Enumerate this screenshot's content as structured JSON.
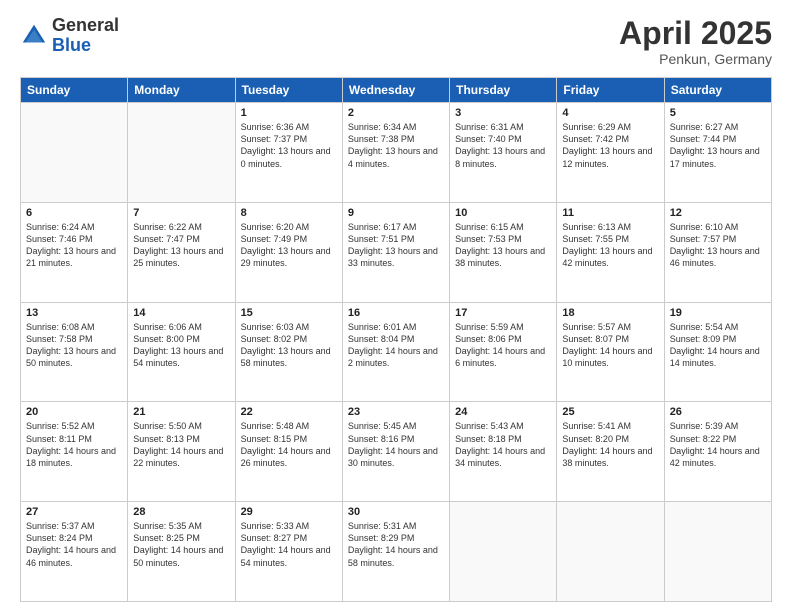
{
  "logo": {
    "general": "General",
    "blue": "Blue"
  },
  "header": {
    "month": "April 2025",
    "location": "Penkun, Germany"
  },
  "weekdays": [
    "Sunday",
    "Monday",
    "Tuesday",
    "Wednesday",
    "Thursday",
    "Friday",
    "Saturday"
  ],
  "weeks": [
    [
      {
        "day": "",
        "info": ""
      },
      {
        "day": "",
        "info": ""
      },
      {
        "day": "1",
        "info": "Sunrise: 6:36 AM\nSunset: 7:37 PM\nDaylight: 13 hours and 0 minutes."
      },
      {
        "day": "2",
        "info": "Sunrise: 6:34 AM\nSunset: 7:38 PM\nDaylight: 13 hours and 4 minutes."
      },
      {
        "day": "3",
        "info": "Sunrise: 6:31 AM\nSunset: 7:40 PM\nDaylight: 13 hours and 8 minutes."
      },
      {
        "day": "4",
        "info": "Sunrise: 6:29 AM\nSunset: 7:42 PM\nDaylight: 13 hours and 12 minutes."
      },
      {
        "day": "5",
        "info": "Sunrise: 6:27 AM\nSunset: 7:44 PM\nDaylight: 13 hours and 17 minutes."
      }
    ],
    [
      {
        "day": "6",
        "info": "Sunrise: 6:24 AM\nSunset: 7:46 PM\nDaylight: 13 hours and 21 minutes."
      },
      {
        "day": "7",
        "info": "Sunrise: 6:22 AM\nSunset: 7:47 PM\nDaylight: 13 hours and 25 minutes."
      },
      {
        "day": "8",
        "info": "Sunrise: 6:20 AM\nSunset: 7:49 PM\nDaylight: 13 hours and 29 minutes."
      },
      {
        "day": "9",
        "info": "Sunrise: 6:17 AM\nSunset: 7:51 PM\nDaylight: 13 hours and 33 minutes."
      },
      {
        "day": "10",
        "info": "Sunrise: 6:15 AM\nSunset: 7:53 PM\nDaylight: 13 hours and 38 minutes."
      },
      {
        "day": "11",
        "info": "Sunrise: 6:13 AM\nSunset: 7:55 PM\nDaylight: 13 hours and 42 minutes."
      },
      {
        "day": "12",
        "info": "Sunrise: 6:10 AM\nSunset: 7:57 PM\nDaylight: 13 hours and 46 minutes."
      }
    ],
    [
      {
        "day": "13",
        "info": "Sunrise: 6:08 AM\nSunset: 7:58 PM\nDaylight: 13 hours and 50 minutes."
      },
      {
        "day": "14",
        "info": "Sunrise: 6:06 AM\nSunset: 8:00 PM\nDaylight: 13 hours and 54 minutes."
      },
      {
        "day": "15",
        "info": "Sunrise: 6:03 AM\nSunset: 8:02 PM\nDaylight: 13 hours and 58 minutes."
      },
      {
        "day": "16",
        "info": "Sunrise: 6:01 AM\nSunset: 8:04 PM\nDaylight: 14 hours and 2 minutes."
      },
      {
        "day": "17",
        "info": "Sunrise: 5:59 AM\nSunset: 8:06 PM\nDaylight: 14 hours and 6 minutes."
      },
      {
        "day": "18",
        "info": "Sunrise: 5:57 AM\nSunset: 8:07 PM\nDaylight: 14 hours and 10 minutes."
      },
      {
        "day": "19",
        "info": "Sunrise: 5:54 AM\nSunset: 8:09 PM\nDaylight: 14 hours and 14 minutes."
      }
    ],
    [
      {
        "day": "20",
        "info": "Sunrise: 5:52 AM\nSunset: 8:11 PM\nDaylight: 14 hours and 18 minutes."
      },
      {
        "day": "21",
        "info": "Sunrise: 5:50 AM\nSunset: 8:13 PM\nDaylight: 14 hours and 22 minutes."
      },
      {
        "day": "22",
        "info": "Sunrise: 5:48 AM\nSunset: 8:15 PM\nDaylight: 14 hours and 26 minutes."
      },
      {
        "day": "23",
        "info": "Sunrise: 5:45 AM\nSunset: 8:16 PM\nDaylight: 14 hours and 30 minutes."
      },
      {
        "day": "24",
        "info": "Sunrise: 5:43 AM\nSunset: 8:18 PM\nDaylight: 14 hours and 34 minutes."
      },
      {
        "day": "25",
        "info": "Sunrise: 5:41 AM\nSunset: 8:20 PM\nDaylight: 14 hours and 38 minutes."
      },
      {
        "day": "26",
        "info": "Sunrise: 5:39 AM\nSunset: 8:22 PM\nDaylight: 14 hours and 42 minutes."
      }
    ],
    [
      {
        "day": "27",
        "info": "Sunrise: 5:37 AM\nSunset: 8:24 PM\nDaylight: 14 hours and 46 minutes."
      },
      {
        "day": "28",
        "info": "Sunrise: 5:35 AM\nSunset: 8:25 PM\nDaylight: 14 hours and 50 minutes."
      },
      {
        "day": "29",
        "info": "Sunrise: 5:33 AM\nSunset: 8:27 PM\nDaylight: 14 hours and 54 minutes."
      },
      {
        "day": "30",
        "info": "Sunrise: 5:31 AM\nSunset: 8:29 PM\nDaylight: 14 hours and 58 minutes."
      },
      {
        "day": "",
        "info": ""
      },
      {
        "day": "",
        "info": ""
      },
      {
        "day": "",
        "info": ""
      }
    ]
  ]
}
